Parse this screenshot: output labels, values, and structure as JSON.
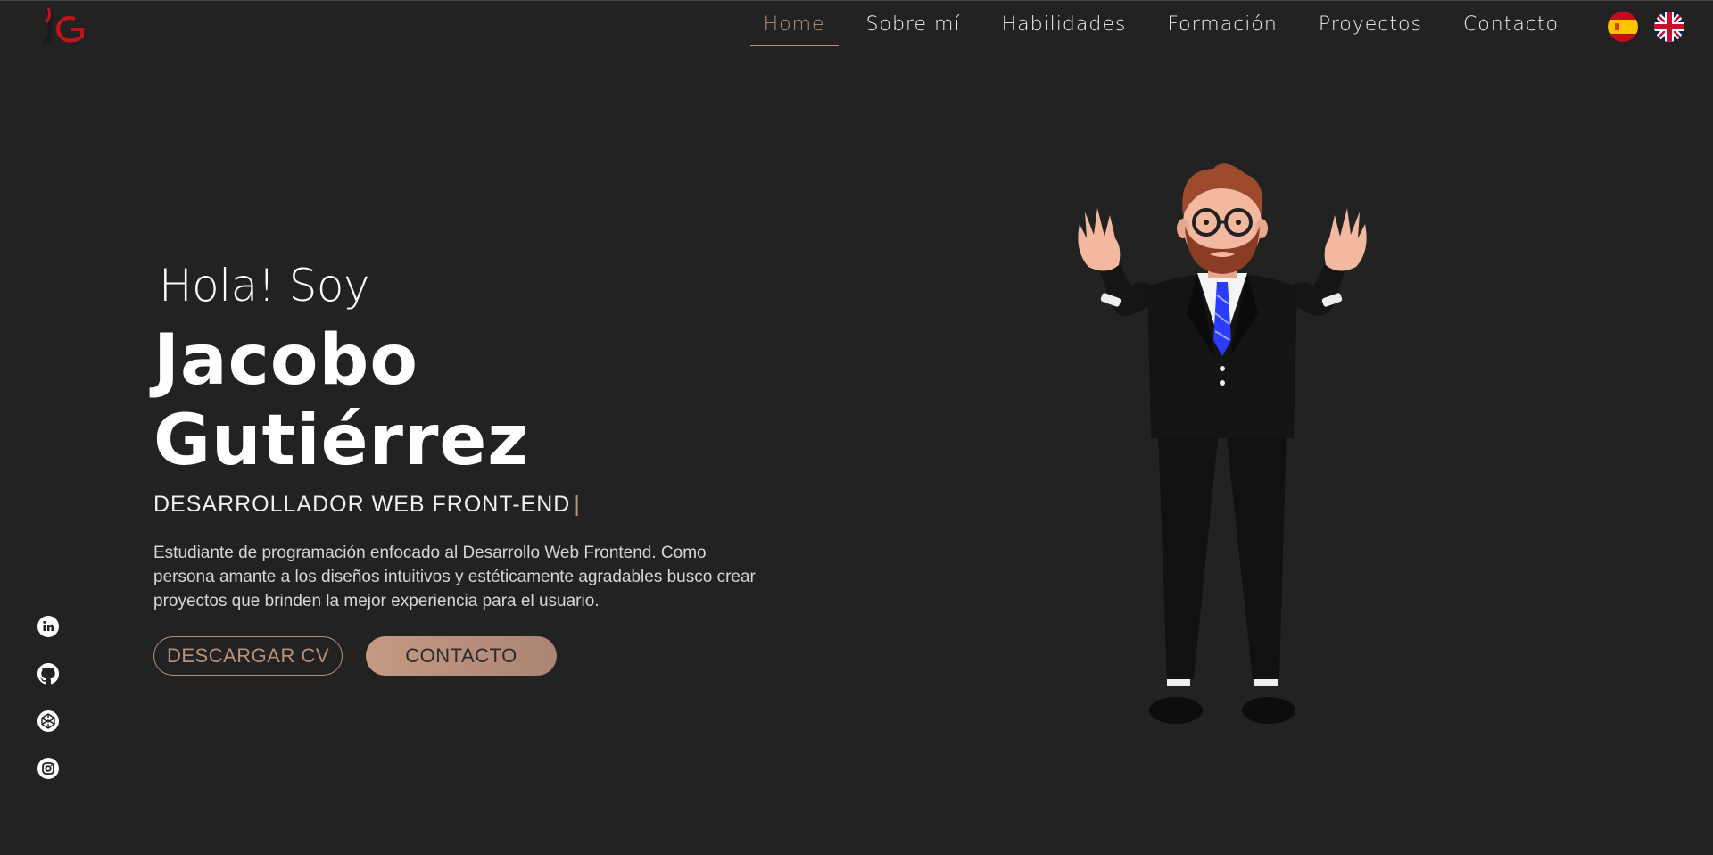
{
  "nav": {
    "items": [
      {
        "label": "Home",
        "active": true
      },
      {
        "label": "Sobre mí",
        "active": false
      },
      {
        "label": "Habilidades",
        "active": false
      },
      {
        "label": "Formación",
        "active": false
      },
      {
        "label": "Proyectos",
        "active": false
      },
      {
        "label": "Contacto",
        "active": false
      }
    ],
    "flags": [
      "spain-flag-icon",
      "uk-flag-icon"
    ]
  },
  "hero": {
    "greeting": "Hola! Soy",
    "name": "Jacobo Gutiérrez",
    "role": "DESARROLLADOR WEB FRONT-END",
    "cursor": "|",
    "description": "Estudiante de programación enfocado al Desarrollo Web Frontend. Como persona amante a los diseños intuitivos y estéticamente agradables busco crear proyectos que brinden la mejor experiencia para el usuario.",
    "cv_button": "DESCARGAR CV",
    "contact_button": "CONTACTO"
  },
  "social": [
    "linkedin-icon",
    "github-icon",
    "codepen-icon",
    "instagram-icon"
  ],
  "colors": {
    "background": "#222222",
    "accent": "#b9907a",
    "text": "#ffffff"
  }
}
